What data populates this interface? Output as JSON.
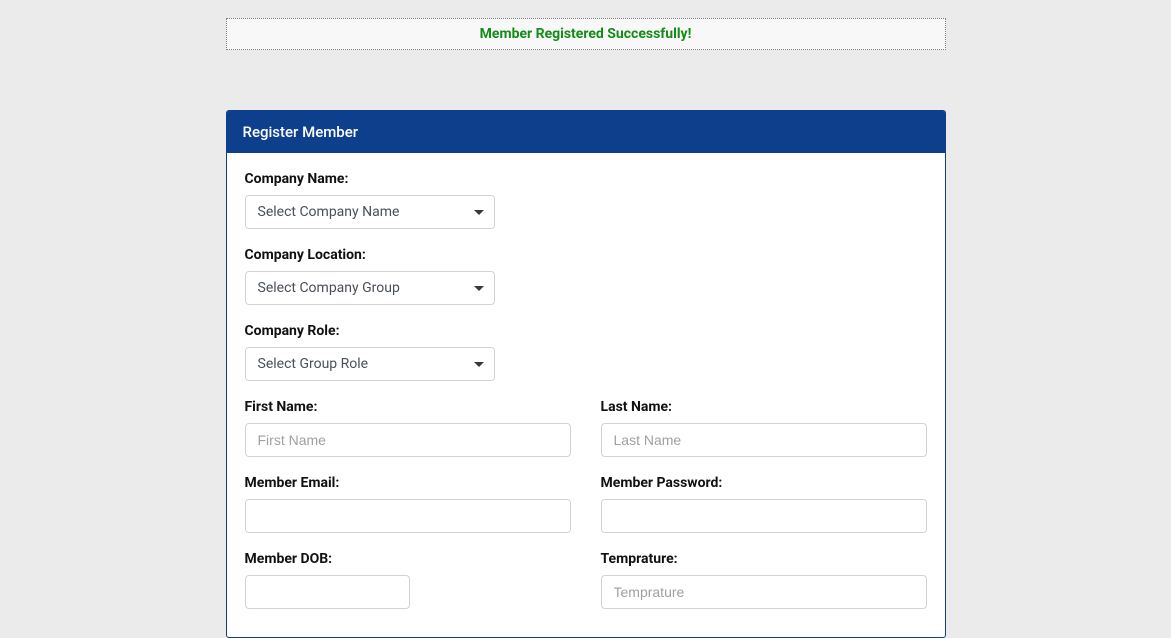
{
  "alert": {
    "message": "Member Registered Successfully!"
  },
  "card": {
    "title": "Register Member"
  },
  "form": {
    "companyName": {
      "label": "Company Name:",
      "selected": "Select Company Name"
    },
    "companyLocation": {
      "label": "Company Location:",
      "selected": "Select Company Group"
    },
    "companyRole": {
      "label": "Company Role:",
      "selected": "Select Group Role"
    },
    "firstName": {
      "label": "First Name:",
      "placeholder": "First Name"
    },
    "lastName": {
      "label": "Last Name:",
      "placeholder": "Last Name"
    },
    "email": {
      "label": "Member Email:"
    },
    "password": {
      "label": "Member Password:"
    },
    "dob": {
      "label": "Member DOB:"
    },
    "temperature": {
      "label": "Temprature:",
      "placeholder": "Temprature"
    }
  }
}
